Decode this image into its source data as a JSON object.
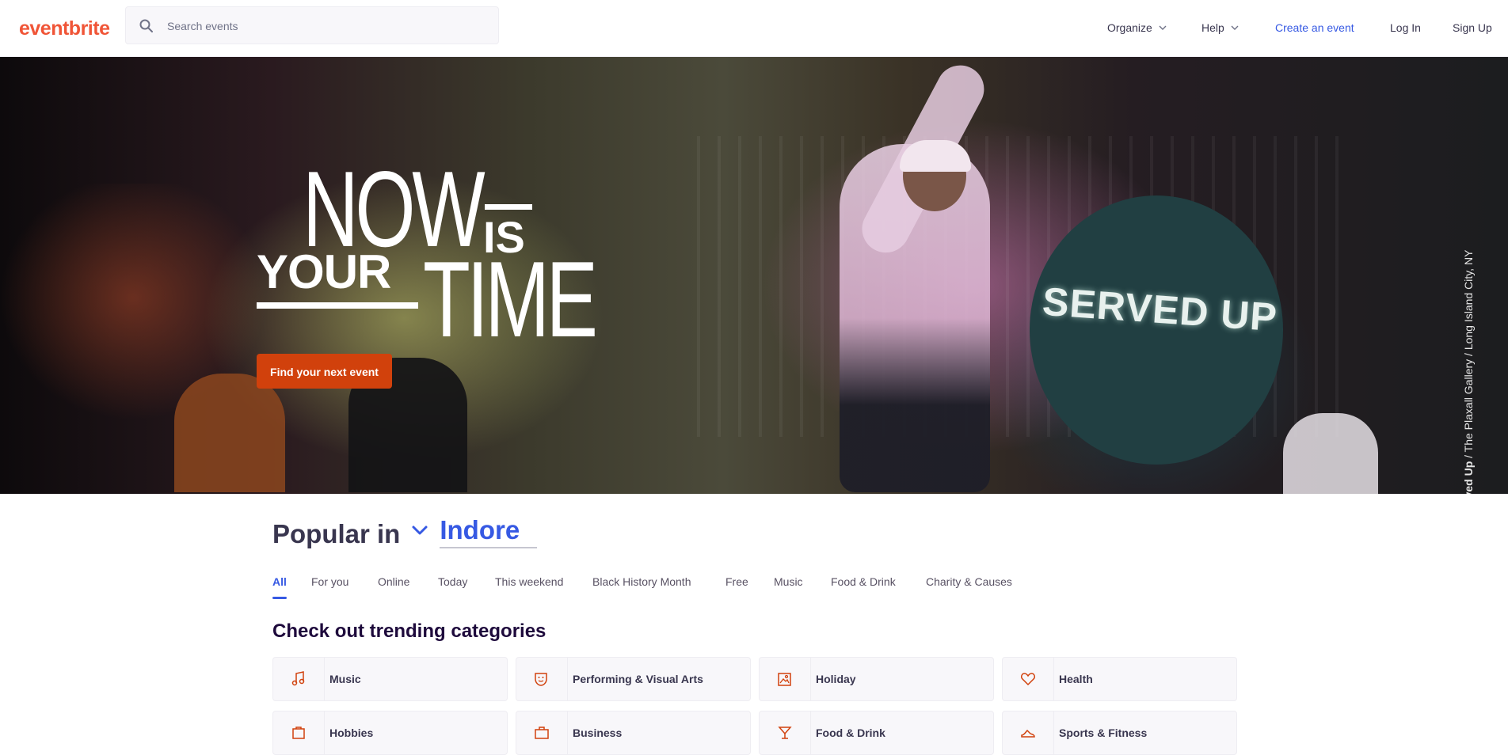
{
  "header": {
    "logo": "eventbrite",
    "search_placeholder": "Search events",
    "nav": {
      "organize": "Organize",
      "help": "Help",
      "create": "Create an event",
      "login": "Log In",
      "signup": "Sign Up"
    }
  },
  "hero": {
    "line_now": "NOW",
    "line_is": "IS",
    "line_your": "YOUR",
    "line_time": "TIME",
    "sign_text": "SERVED UP",
    "cta": "Find your next event",
    "credit_bold": "Served Up",
    "credit_rest": " / The Plaxall Gallery / Long Island City, NY"
  },
  "popular": {
    "label": "Popular in",
    "city": "Indore",
    "tabs": [
      "All",
      "For you",
      "Online",
      "Today",
      "This weekend",
      "Black History Month",
      "Free",
      "Music",
      "Food & Drink",
      "Charity & Causes"
    ]
  },
  "trending": {
    "title": "Check out trending categories",
    "categories": [
      {
        "label": "Music",
        "icon": "music-note-icon"
      },
      {
        "label": "Performing & Visual Arts",
        "icon": "theater-mask-icon"
      },
      {
        "label": "Holiday",
        "icon": "calendar-photo-icon"
      },
      {
        "label": "Health",
        "icon": "heart-icon"
      },
      {
        "label": "Hobbies",
        "icon": "hobbies-icon"
      },
      {
        "label": "Business",
        "icon": "briefcase-icon"
      },
      {
        "label": "Food & Drink",
        "icon": "cocktail-icon"
      },
      {
        "label": "Sports & Fitness",
        "icon": "sports-shoe-icon"
      }
    ]
  },
  "colors": {
    "brand": "#f05537",
    "cta": "#d1410c",
    "link": "#3659e3",
    "text": "#39364f"
  }
}
